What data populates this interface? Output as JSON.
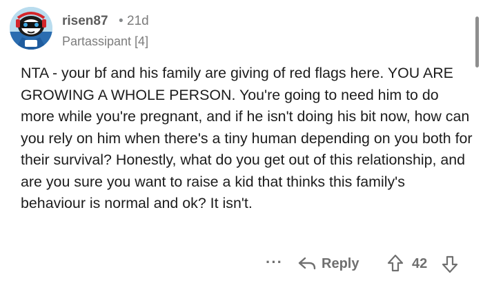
{
  "comment": {
    "username": "risen87",
    "separator": "•",
    "age": "21d",
    "flair": "Partassipant [4]",
    "body": "NTA - your bf and his family are giving of red flags here. YOU ARE GROWING A WHOLE PERSON. You're going to need him to do more while you're pregnant, and if he isn't doing his bit now, how can you rely on him when there's a tiny human depending on you both for their survival? Honestly, what do you get out of this relationship, and are you sure you want to raise a kid that thinks this family's behaviour is normal and ok? It isn't."
  },
  "actions": {
    "more_label": "···",
    "reply_label": "Reply",
    "score": "42"
  },
  "icons": {
    "avatar": "snoo-avatar-icon",
    "reply": "reply-arrow-icon",
    "upvote": "upvote-arrow-icon",
    "downvote": "downvote-arrow-icon"
  },
  "colors": {
    "text": "#1c1c1c",
    "meta": "#7c7c7c",
    "action": "#6f6f6f"
  }
}
